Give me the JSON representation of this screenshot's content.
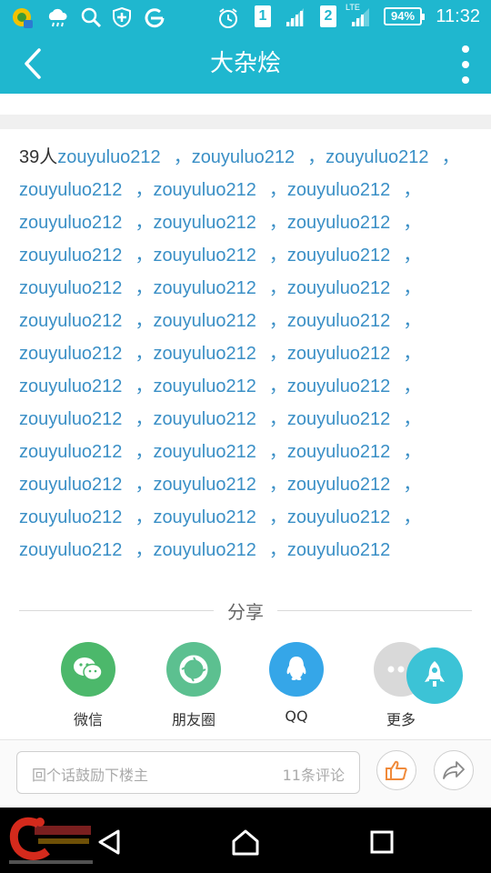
{
  "status_bar": {
    "time": "11:32",
    "battery": "94%",
    "sim1": "1",
    "sim2": "2",
    "network_tag": "LTE"
  },
  "app_bar": {
    "title": "大杂烩"
  },
  "likes": {
    "count_text": "39人",
    "names": [
      [
        "zouyuluo212",
        "zouyuluo212",
        "zouyuluo212"
      ],
      [
        "zouyuluo212",
        "zouyuluo212",
        "zouyuluo212"
      ],
      [
        "zouyuluo212",
        "zouyuluo212",
        "zouyuluo212"
      ],
      [
        "zouyuluo212",
        "zouyuluo212",
        "zouyuluo212"
      ],
      [
        "zouyuluo212",
        "zouyuluo212",
        "zouyuluo212"
      ],
      [
        "zouyuluo212",
        "zouyuluo212",
        "zouyuluo212"
      ],
      [
        "zouyuluo212",
        "zouyuluo212",
        "zouyuluo212"
      ],
      [
        "zouyuluo212",
        "zouyuluo212",
        "zouyuluo212"
      ],
      [
        "zouyuluo212",
        "zouyuluo212",
        "zouyuluo212"
      ],
      [
        "zouyuluo212",
        "zouyuluo212",
        "zouyuluo212"
      ],
      [
        "zouyuluo212",
        "zouyuluo212",
        "zouyuluo212"
      ],
      [
        "zouyuluo212",
        "zouyuluo212",
        "zouyuluo212"
      ],
      [
        "zouyuluo212",
        "zouyuluo212",
        "zouyuluo212"
      ]
    ],
    "separator": "，"
  },
  "share": {
    "title": "分享",
    "items": [
      {
        "label": "微信",
        "icon": "wechat-icon",
        "color": "#4cb86b"
      },
      {
        "label": "朋友圈",
        "icon": "moments-icon",
        "color": "#5cc090"
      },
      {
        "label": "QQ",
        "icon": "qq-icon",
        "color": "#35a6e8"
      },
      {
        "label": "更多",
        "icon": "more-icon",
        "color": "#d9d9d9"
      }
    ]
  },
  "comment_bar": {
    "placeholder": "回个话鼓励下楼主",
    "count": "11条评论"
  },
  "colors": {
    "accent": "#1fb7cf",
    "link": "#3a8fc6",
    "like_orange": "#f08a3a"
  }
}
